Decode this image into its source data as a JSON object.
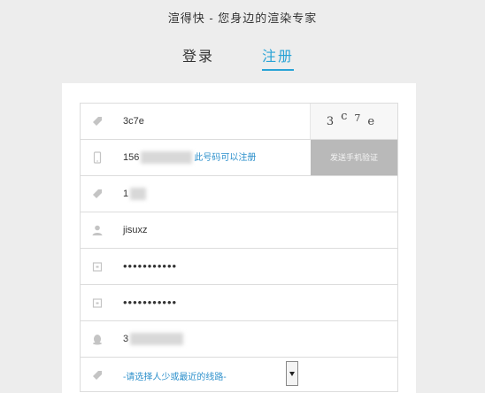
{
  "header": {
    "tagline": "渲得快 - 您身边的渲染专家"
  },
  "tabs": {
    "login": "登录",
    "register": "注册"
  },
  "form": {
    "captcha_value": "3c7e",
    "captcha_image_text": [
      "3",
      "c",
      "7",
      "e"
    ],
    "phone_prefix": "156",
    "phone_hint": "此号码可以注册",
    "send_code_label": "发送手机验证",
    "field3_prefix": "1",
    "username": "jisuxz",
    "password": "•••••••••••",
    "password_confirm": "•••••••••••",
    "qq_prefix": "3",
    "select_placeholder": "-请选择人少或最近的线路-"
  },
  "colors": {
    "accent": "#29a3d6",
    "hint": "#2b8fcb",
    "button_disabled": "#b9b9b9"
  }
}
